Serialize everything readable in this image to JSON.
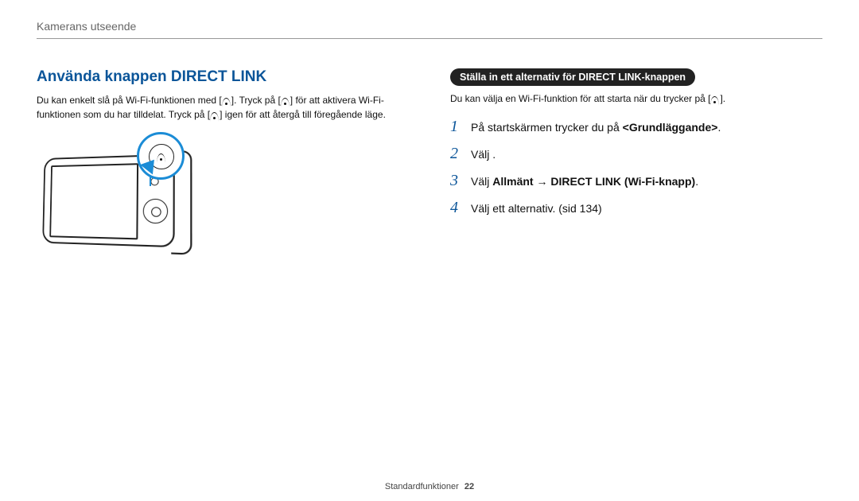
{
  "header": {
    "breadcrumb": "Kamerans utseende"
  },
  "left": {
    "heading": "Använda knappen DIRECT LINK",
    "body_a": "Du kan enkelt slå på Wi-Fi-funktionen med [",
    "body_b": "]. Tryck på [",
    "body_c": "] för att aktivera Wi-Fi-funktionen som du har tilldelat. Tryck på [",
    "body_d": "] igen för att återgå till föregående läge."
  },
  "right": {
    "pill": "Ställa in ett alternativ för DIRECT LINK-knappen",
    "body_a": "Du kan välja en Wi-Fi-funktion för att starta när du trycker på [",
    "body_b": "].",
    "steps": [
      {
        "num": "1",
        "text_a": "På startskärmen trycker du på ",
        "bold_a": "<Grundläggande>",
        "text_b": "."
      },
      {
        "num": "2",
        "text_a": "Välj ",
        "text_b": "."
      },
      {
        "num": "3",
        "text_a": "Välj ",
        "bold_a": "Allmänt → DIRECT LINK (Wi-Fi-knapp)",
        "text_b": "."
      },
      {
        "num": "4",
        "text_a": "Välj ett alternativ. (sid 134)"
      }
    ]
  },
  "footer": {
    "section": "Standardfunktioner",
    "page": "22"
  }
}
